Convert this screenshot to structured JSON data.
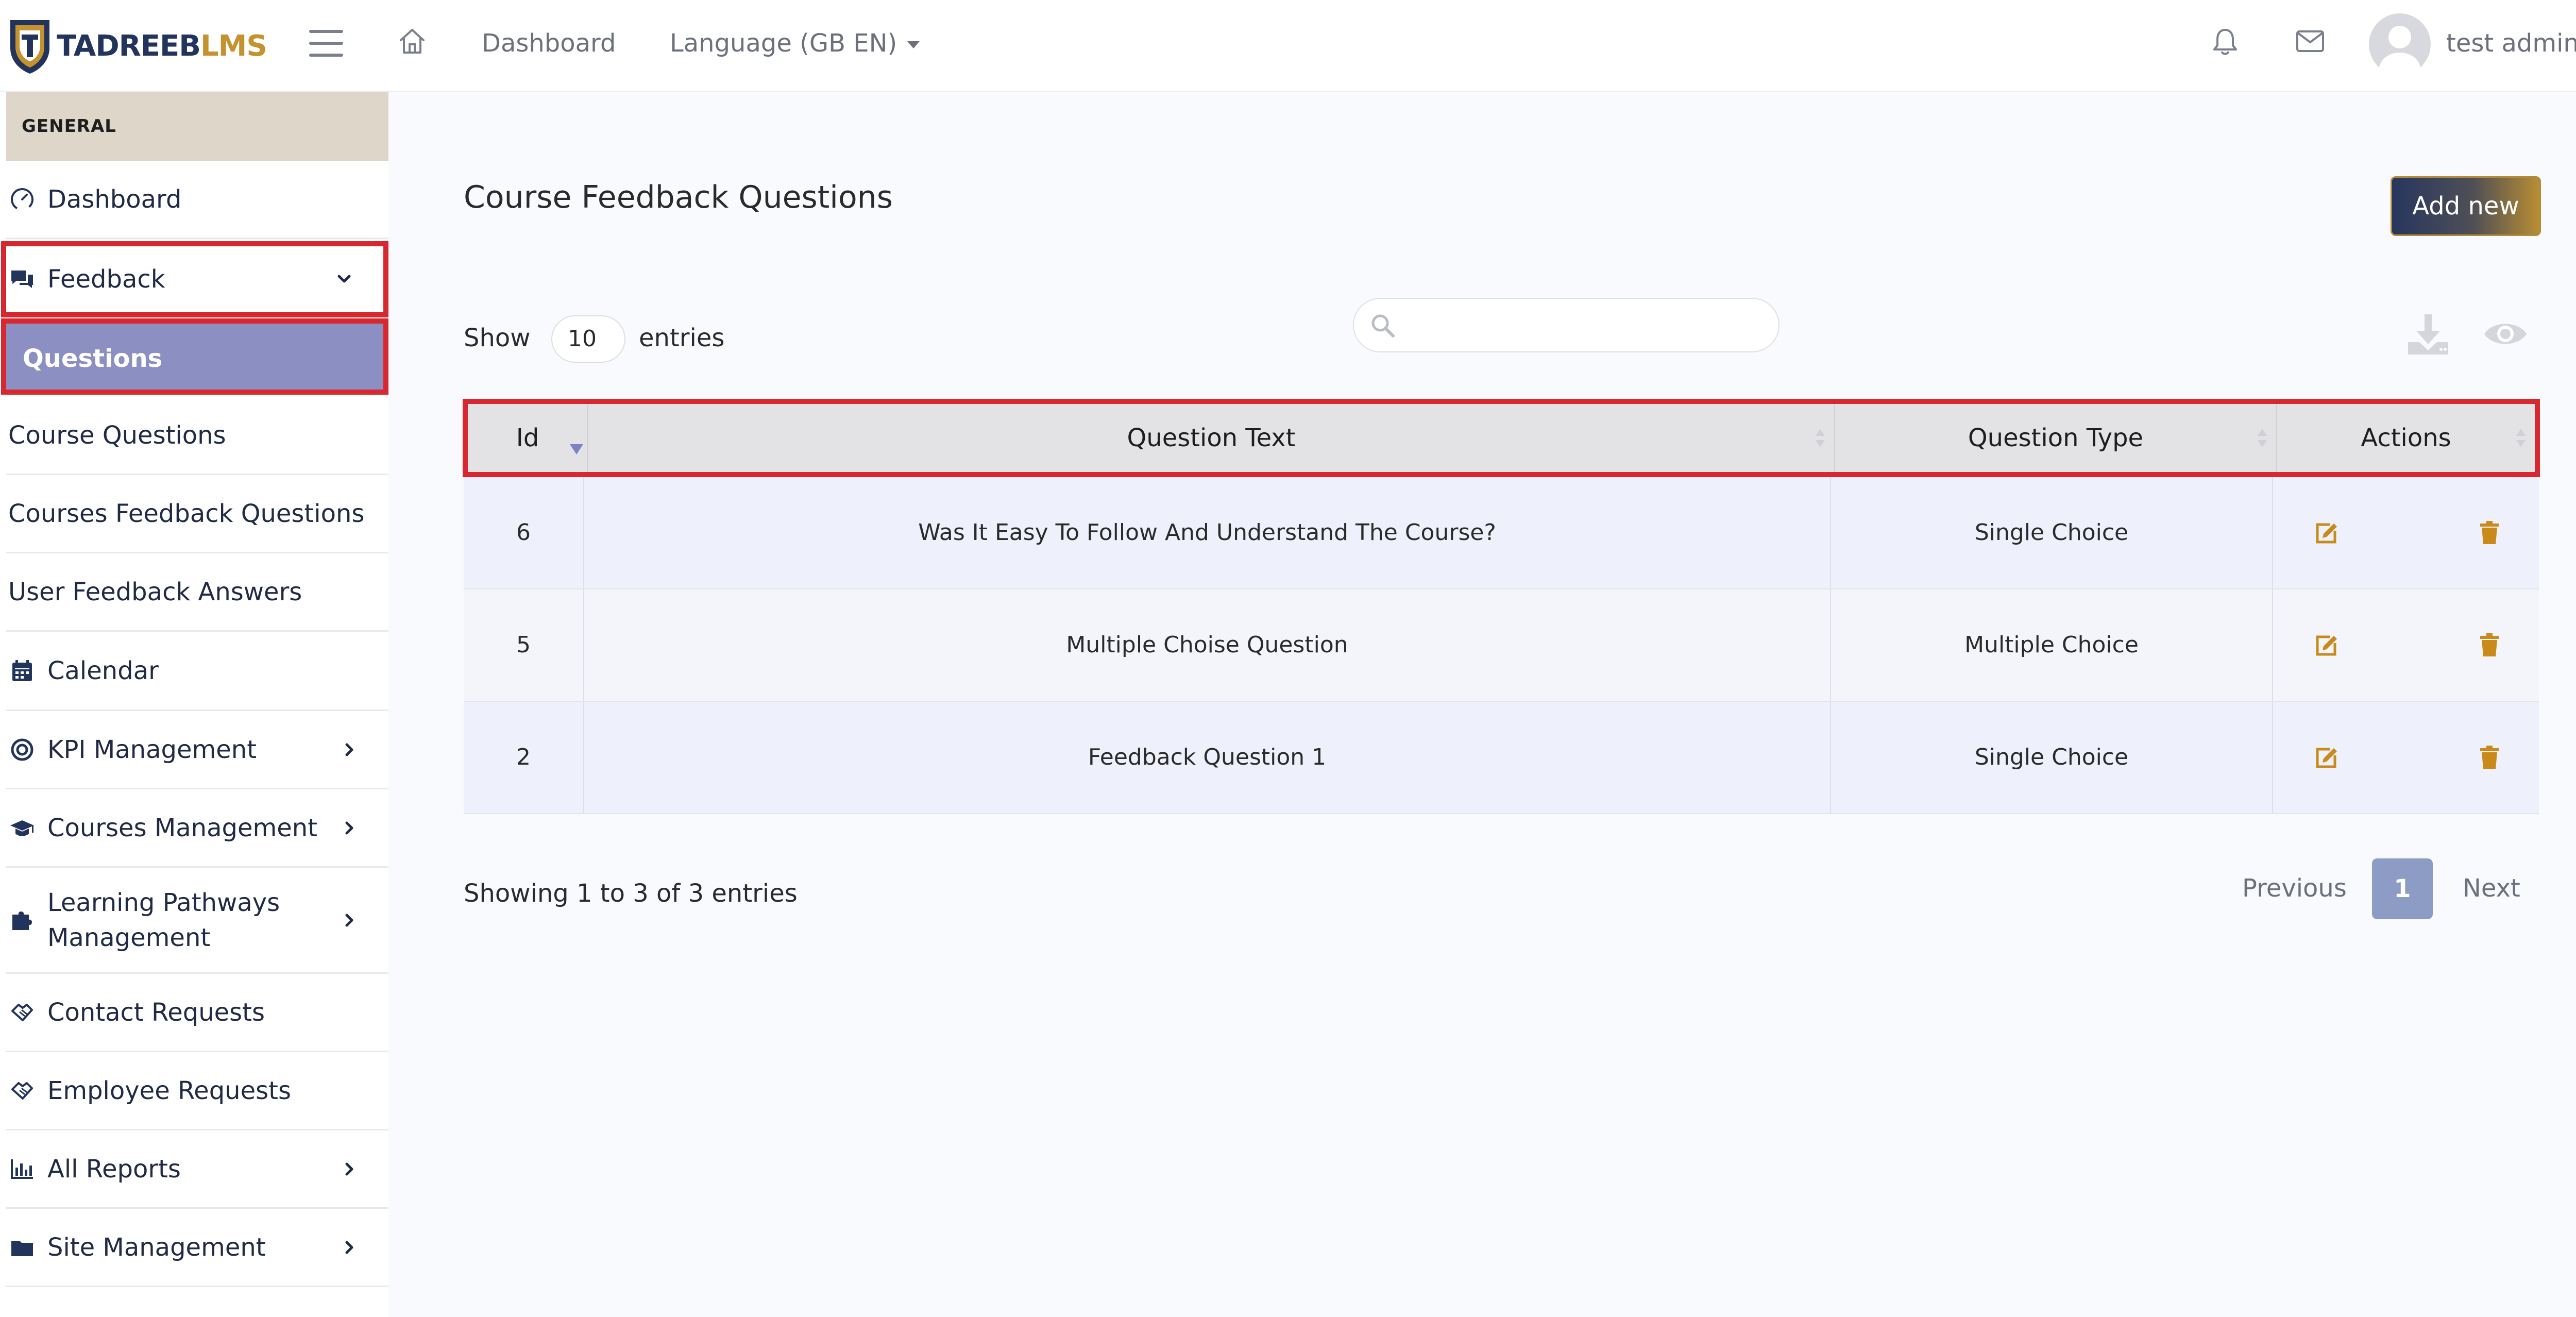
{
  "brand": {
    "name_part1": "TADREEB",
    "name_part2": "LMS"
  },
  "topbar": {
    "dashboard_label": "Dashboard",
    "language_label": "Language (GB EN)",
    "user_name": "test admin"
  },
  "sidebar": {
    "section_label": "GENERAL",
    "items": [
      {
        "label": "Dashboard",
        "icon": "gauge-icon"
      },
      {
        "label": "Feedback",
        "icon": "chat-icon",
        "expanded": true
      },
      {
        "label": "Questions",
        "active": true
      },
      {
        "label": "Course Questions"
      },
      {
        "label": "Courses Feedback Questions"
      },
      {
        "label": "User Feedback Answers"
      },
      {
        "label": "Calendar",
        "icon": "calendar-icon"
      },
      {
        "label": "KPI Management",
        "icon": "target-icon"
      },
      {
        "label": "Courses Management",
        "icon": "graduation-cap-icon"
      },
      {
        "label": "Learning Pathways",
        "label2": "Management",
        "icon": "puzzle-icon"
      },
      {
        "label": "Contact Requests",
        "icon": "handshake-icon"
      },
      {
        "label": "Employee Requests",
        "icon": "handshake-icon"
      },
      {
        "label": "All Reports",
        "icon": "bar-chart-icon"
      },
      {
        "label": "Site Management",
        "icon": "folder-icon"
      }
    ]
  },
  "main": {
    "title": "Course Feedback Questions",
    "add_button_label": "Add new",
    "show_label": "Show",
    "entries_value": "10",
    "entries_label": "entries",
    "search_placeholder": "",
    "table": {
      "columns": [
        "Id",
        "Question Text",
        "Question Type",
        "Actions"
      ],
      "rows": [
        {
          "id": "6",
          "text": "Was It Easy To Follow And Understand The Course?",
          "type": "Single Choice"
        },
        {
          "id": "5",
          "text": "Multiple Choise Question",
          "type": "Multiple Choice"
        },
        {
          "id": "2",
          "text": "Feedback Question 1",
          "type": "Single Choice"
        }
      ]
    },
    "showing_text": "Showing 1 to 3 of 3 entries",
    "pagination": {
      "previous": "Previous",
      "current": "1",
      "next": "Next"
    }
  },
  "colors": {
    "brand_navy": "#22335c",
    "brand_gold": "#c4932f",
    "highlight_red": "#d8272e",
    "active_item": "#8c8fc2",
    "action_icon": "#c98a1a"
  }
}
